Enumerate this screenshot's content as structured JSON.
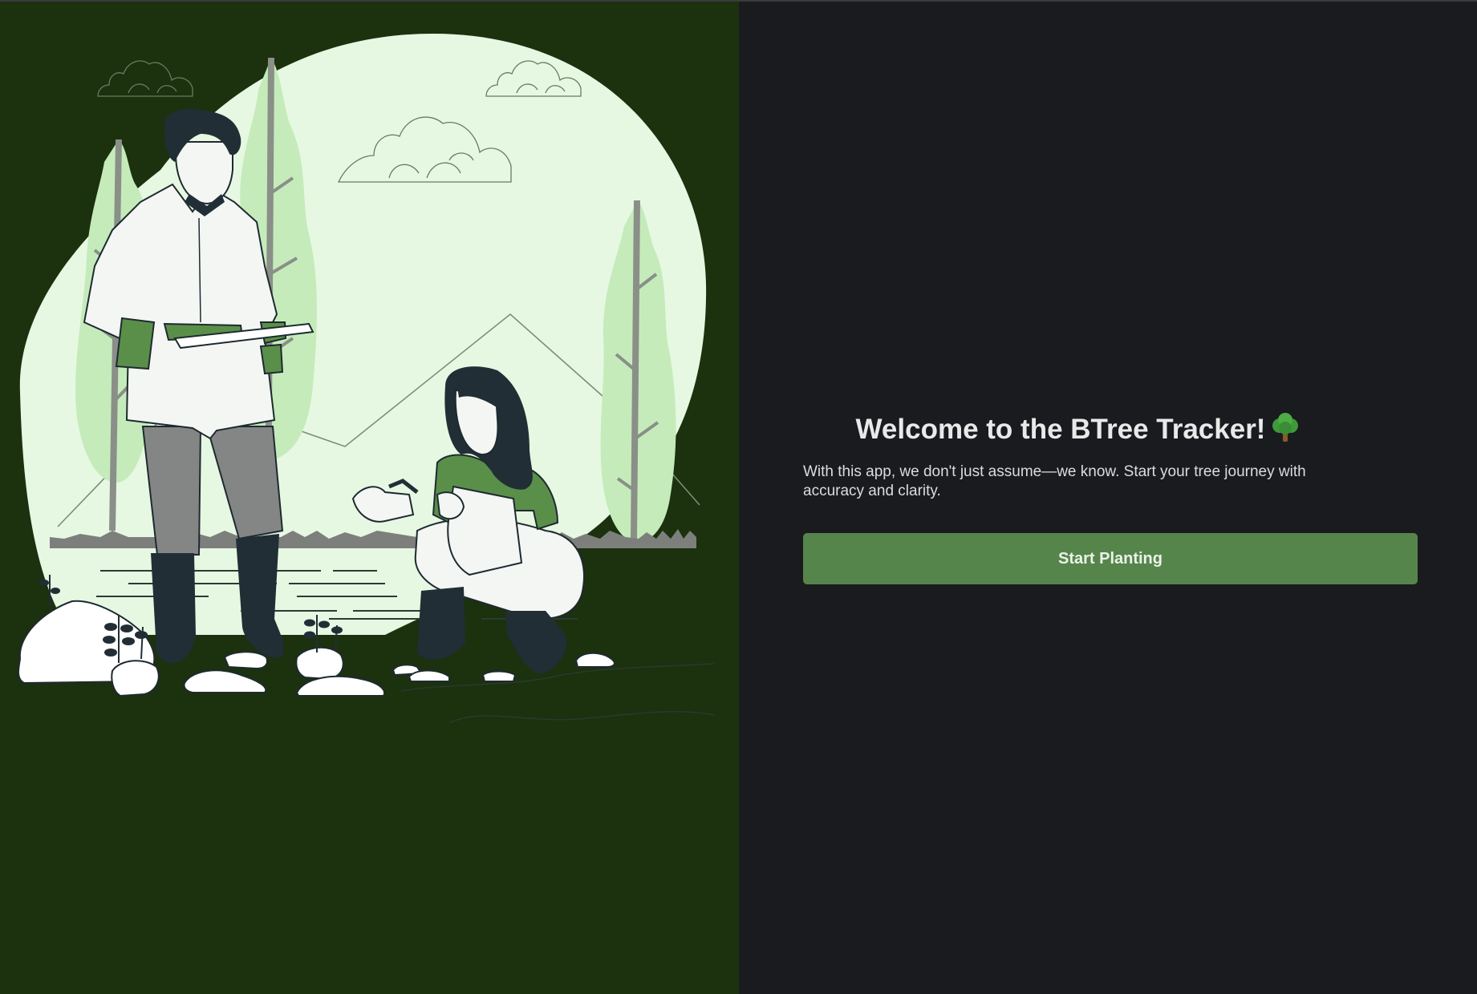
{
  "welcome": {
    "title": "Welcome to the BTree Tracker!",
    "emoji_icon": "deciduous-tree-icon",
    "description": "With this app, we don't just assume—we know. Start your tree journey with accuracy and clarity.",
    "start_button_label": "Start Planting"
  },
  "illustration": {
    "name": "people-planting-trees-illustration",
    "icons": [
      "cloud-icon",
      "pine-tree-icon",
      "man-holding-tablet-figure",
      "woman-planting-figure",
      "rock-icon",
      "sprout-icon"
    ]
  },
  "colors": {
    "left_background": "#1c310e",
    "right_background": "#1a1b1e",
    "accent_green": "#55854a",
    "pale_green": "#e6f8e2",
    "tree_green": "#c5ebbb",
    "title_text": "#e9e9ea"
  }
}
